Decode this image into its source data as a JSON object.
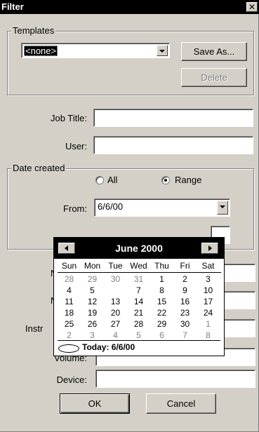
{
  "window": {
    "title": "Filter",
    "close_glyph": "✕"
  },
  "templates": {
    "group_label": "Templates",
    "selected": "<none>",
    "save_as_label": "Save As...",
    "delete_label": "Delete"
  },
  "fields": {
    "job_title_label": "Job Title:",
    "job_title_value": "",
    "user_label": "User:",
    "user_value": "",
    "volume_label": "Volume:",
    "device_label": "Device:"
  },
  "date_created": {
    "group_label": "Date created",
    "option_all": "All",
    "option_range": "Range",
    "selected_option": "Range",
    "from_label": "From:",
    "from_value": "6/6/00"
  },
  "hidden_labels": {
    "row1": "N",
    "row2": "N",
    "row3": "Instr"
  },
  "calendar": {
    "month_title": "June 2000",
    "weekdays": [
      "Sun",
      "Mon",
      "Tue",
      "Wed",
      "Thu",
      "Fri",
      "Sat"
    ],
    "weeks": [
      [
        "28",
        "29",
        "30",
        "31",
        "1",
        "2",
        "3"
      ],
      [
        "4",
        "5",
        "6",
        "7",
        "8",
        "9",
        "10"
      ],
      [
        "11",
        "12",
        "13",
        "14",
        "15",
        "16",
        "17"
      ],
      [
        "18",
        "19",
        "20",
        "21",
        "22",
        "23",
        "24"
      ],
      [
        "25",
        "26",
        "27",
        "28",
        "29",
        "30",
        "1"
      ],
      [
        "2",
        "3",
        "4",
        "5",
        "6",
        "7",
        "8"
      ]
    ],
    "selected_day": "6",
    "today_label": "Today: 6/6/00"
  },
  "buttons": {
    "ok_label": "OK",
    "cancel_label": "Cancel"
  }
}
